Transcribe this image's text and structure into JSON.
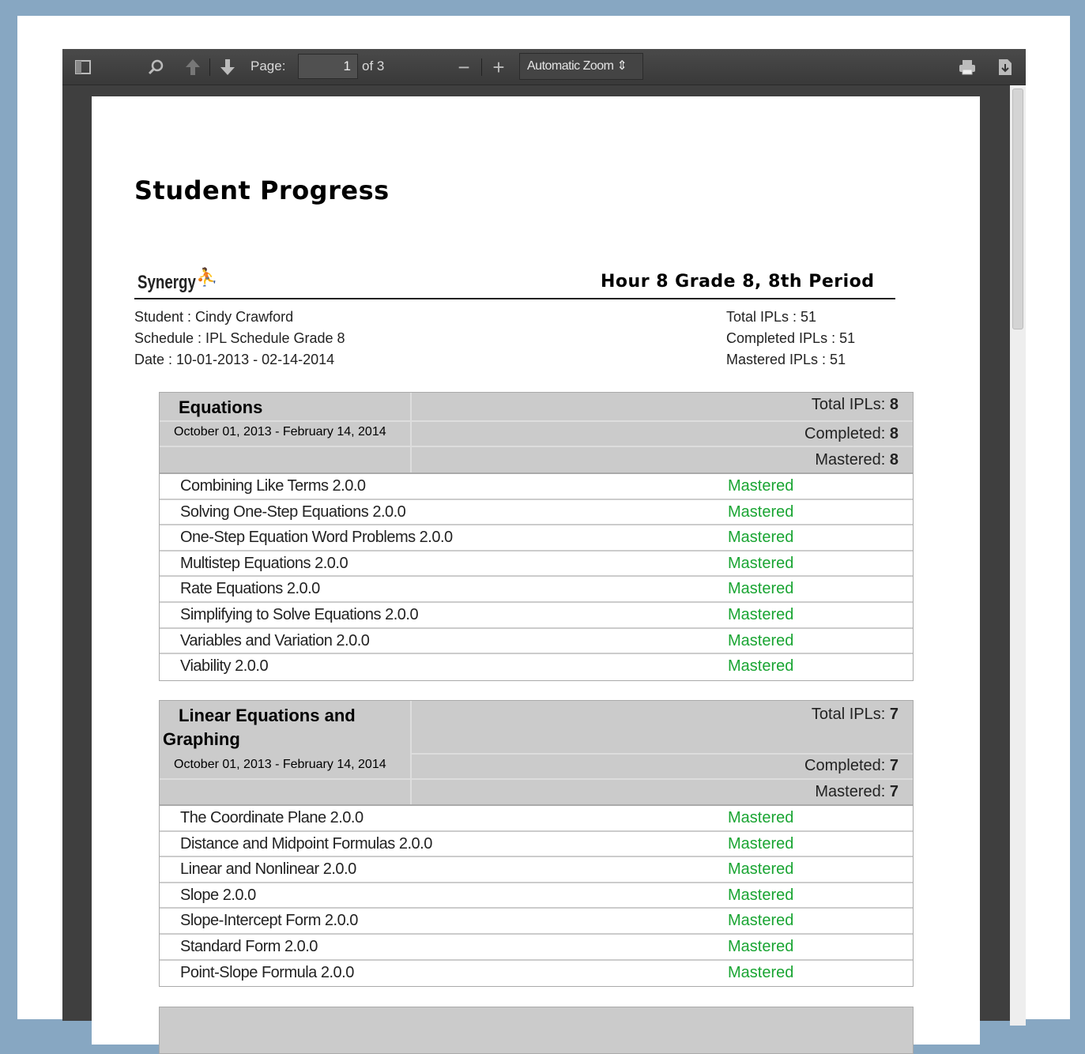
{
  "toolbar": {
    "page_label": "Page:",
    "page_value": "1",
    "page_of": "of 3",
    "zoom_select": "Automatic Zoom"
  },
  "report": {
    "title": "Student Progress",
    "logo_text": "Synergy",
    "class_title": "Hour 8 Grade 8, 8th Period",
    "student": "Student : Cindy Crawford",
    "schedule": "Schedule : IPL Schedule Grade 8",
    "date": "Date : 10-01-2013  -  02-14-2014",
    "total": "Total IPLs : 51",
    "completed": "Completed IPLs : 51",
    "mastered": "Mastered IPLs : 51"
  },
  "sections": [
    {
      "title": "Equations",
      "dates": "October 01, 2013 - February 14, 2014",
      "total_label": "Total IPLs:",
      "total": "8",
      "completed_label": "Completed:",
      "completed": "8",
      "mastered_label": "Mastered:",
      "mastered": "8",
      "items": [
        [
          "Combining Like Terms 2.0.0",
          "Mastered"
        ],
        [
          "Solving One-Step Equations 2.0.0",
          "Mastered"
        ],
        [
          "One-Step Equation Word Problems 2.0.0",
          "Mastered"
        ],
        [
          "Multistep Equations 2.0.0",
          "Mastered"
        ],
        [
          "Rate Equations 2.0.0",
          "Mastered"
        ],
        [
          "Simplifying to Solve Equations 2.0.0",
          "Mastered"
        ],
        [
          "Variables and Variation 2.0.0",
          "Mastered"
        ],
        [
          "Viability 2.0.0",
          "Mastered"
        ]
      ]
    },
    {
      "title_line1": "Linear Equations and",
      "title_line2": "Graphing",
      "dates": "October 01, 2013 - February 14, 2014",
      "total_label": "Total IPLs:",
      "total": "7",
      "completed_label": "Completed:",
      "completed": "7",
      "mastered_label": "Mastered:",
      "mastered": "7",
      "items": [
        [
          "The Coordinate Plane 2.0.0",
          "Mastered"
        ],
        [
          "Distance and Midpoint Formulas 2.0.0",
          "Mastered"
        ],
        [
          "Linear and Nonlinear 2.0.0",
          "Mastered"
        ],
        [
          "Slope 2.0.0",
          "Mastered"
        ],
        [
          "Slope-Intercept Form 2.0.0",
          "Mastered"
        ],
        [
          "Standard Form 2.0.0",
          "Mastered"
        ],
        [
          "Point-Slope Formula 2.0.0",
          "Mastered"
        ]
      ]
    }
  ]
}
